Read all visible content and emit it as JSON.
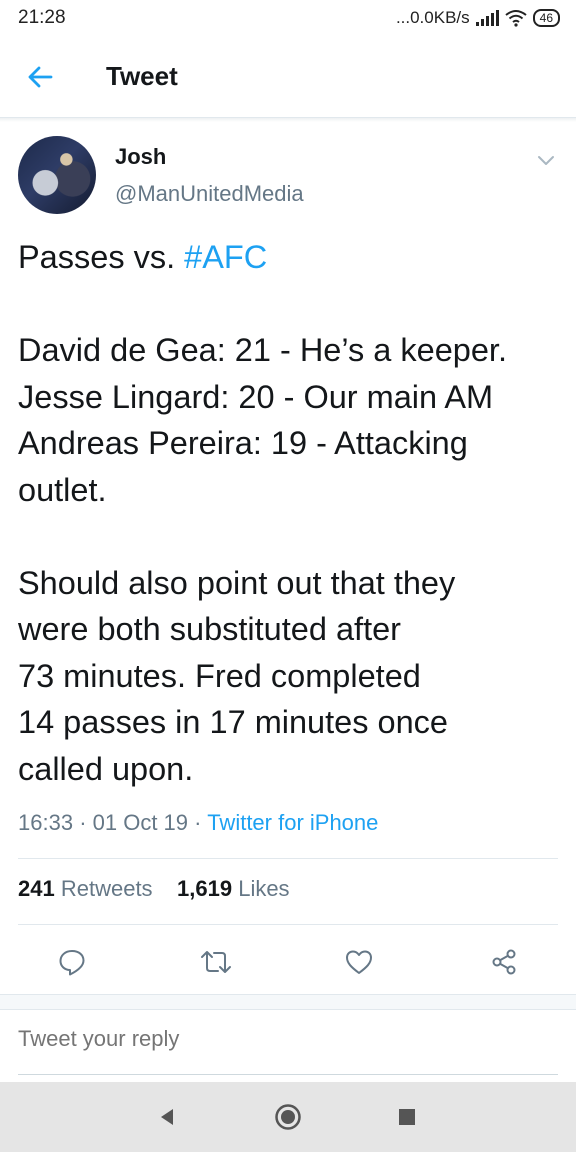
{
  "status_bar": {
    "time": "21:28",
    "network": "...0.0KB/s",
    "battery": "46"
  },
  "app_bar": {
    "title": "Tweet",
    "back_icon": "arrow-left-icon"
  },
  "tweet": {
    "author_name": "Josh",
    "author_handle": "@ManUnitedMedia",
    "lines": {
      "l1_prefix": "Passes vs. ",
      "l1_hashtag": "#AFC",
      "l2": "David de Gea: 21 - He’s a keeper.",
      "l3": "Jesse Lingard: 20 - Our main AM",
      "l4": "Andreas Pereira: 19 - Attacking",
      "l5": "outlet.",
      "l6": "Should also point out that they",
      "l7": "were both substituted after",
      "l8": "73 minutes. Fred completed",
      "l9": "14 passes in 17 minutes once",
      "l10": "called upon."
    },
    "time": "16:33",
    "date": "01 Oct 19",
    "source": "Twitter for iPhone",
    "retweets_count": "241",
    "retweets_label": "Retweets",
    "likes_count": "1,619",
    "likes_label": "Likes"
  },
  "reply": {
    "placeholder": "Tweet your reply"
  },
  "colors": {
    "accent": "#1da1f2",
    "secondary_text": "#657786",
    "primary_text": "#14171a"
  }
}
